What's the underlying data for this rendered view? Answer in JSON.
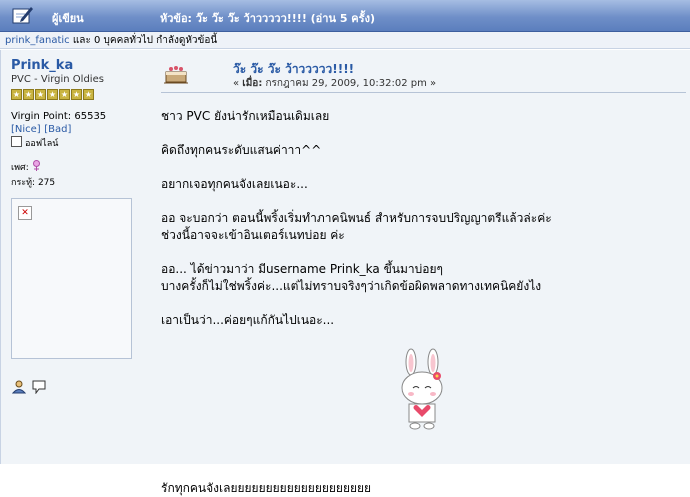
{
  "header": {
    "author_col": "ผู้เขียน",
    "topic_col": "หัวข้อ: ว๊ะ ว๊ะ ว๊ะ ว้าววววว!!!!  (อ่าน 5 ครั้ง)"
  },
  "viewers": {
    "user_link": "prink_fanatic",
    "rest": " และ 0 บุคคลทั่วไป กำลังดูหัวข้อนี้"
  },
  "poster": {
    "username": "Prink_ka",
    "group": "PVC - Virgin Oldies",
    "stars": 7,
    "points": "Virgin Point: 65535",
    "karma_nice": "[Nice]",
    "karma_bad": "[Bad]",
    "online": "ออฟไลน์",
    "gender_label": "เพศ:",
    "post_count": "กระทู้: 275"
  },
  "post": {
    "subject": "ว๊ะ ว๊ะ ว๊ะ ว้าววววว!!!!",
    "meta_prefix": "« ",
    "meta_on": "เมื่อ:",
    "date": " กรกฎาคม 29, 2009, 10:32:02 pm »",
    "body": [
      "ชาว PVC ยังน่ารักเหมือนเดิมเลย",
      "คิดถึงทุกคนระดับแสนค่าาา^^",
      "อยากเจอทุกคนจังเลยเนอะ...",
      "ออ จะบอกว่า ตอนนี้พริ้งเริ่มทำภาคนิพนธ์ สำหรับการจบปริญญาตรีแล้วล่ะค่ะ",
      "ช่วงนี้อาจจะเข้าอินเตอร์เนทบ่อย ค่ะ",
      "ออ... ได้ข่าวมาว่า มีusername Prink_ka ขึ้นมาบ่อยๆ",
      "บางครั้งก็ไม่ใช่พริ้งค่ะ...แต่ไม่ทราบจริงๆว่าเกิดข้อผิดพลาดทางเทคนิคยังไง",
      "เอาเป็นว่า...ค่อยๆแก้กันไปเนอะ...",
      "รักทุกคนจังเลยยยยยยยยยยยยยยยยยยยย"
    ]
  },
  "colors": {
    "header_bg": "#6f8fc8",
    "link": "#2a5aa5",
    "post_bg": "#f0f4f8"
  }
}
